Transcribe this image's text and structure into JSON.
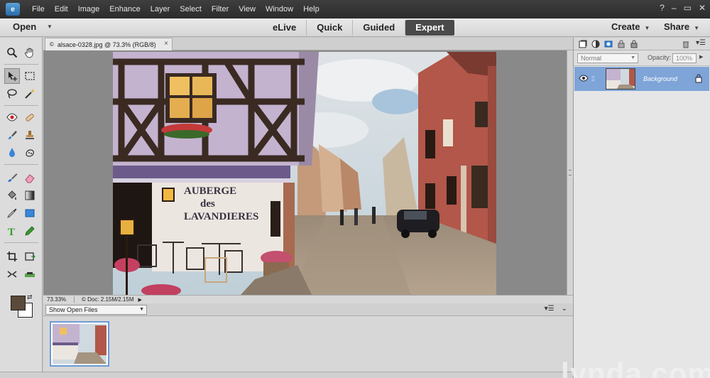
{
  "menubar": {
    "logo_letter": "e",
    "items": [
      "File",
      "Edit",
      "Image",
      "Enhance",
      "Layer",
      "Select",
      "Filter",
      "View",
      "Window",
      "Help"
    ],
    "window_controls": [
      "?",
      "–",
      "▭",
      "✕"
    ]
  },
  "modebar": {
    "open_label": "Open",
    "tabs": [
      "eLive",
      "Quick",
      "Guided",
      "Expert"
    ],
    "active_tab": "Expert",
    "create_label": "Create",
    "share_label": "Share"
  },
  "document": {
    "tab_label": "alsace-0328.jpg @ 73.3% (RGB/8)",
    "close_glyph": "×",
    "zoom": "73.33%",
    "doc_size": "Doc: 2.15M/2.15M",
    "sign_line1": "AUBERGE",
    "sign_line2": "des",
    "sign_line3": "LAVANDIERES"
  },
  "photo_bin": {
    "selector_value": "Show Open Files"
  },
  "layers": {
    "blend_mode": "Normal",
    "opacity_label": "Opacity:",
    "opacity_value": "100%",
    "layer_name": "Background"
  },
  "watermark": "lynda.com",
  "colors": {
    "foreground_swatch": "#5a4a3a",
    "background_swatch": "#ffffff",
    "layer_selected": "#7ea4d8",
    "active_tab": "#4a4a4a"
  }
}
